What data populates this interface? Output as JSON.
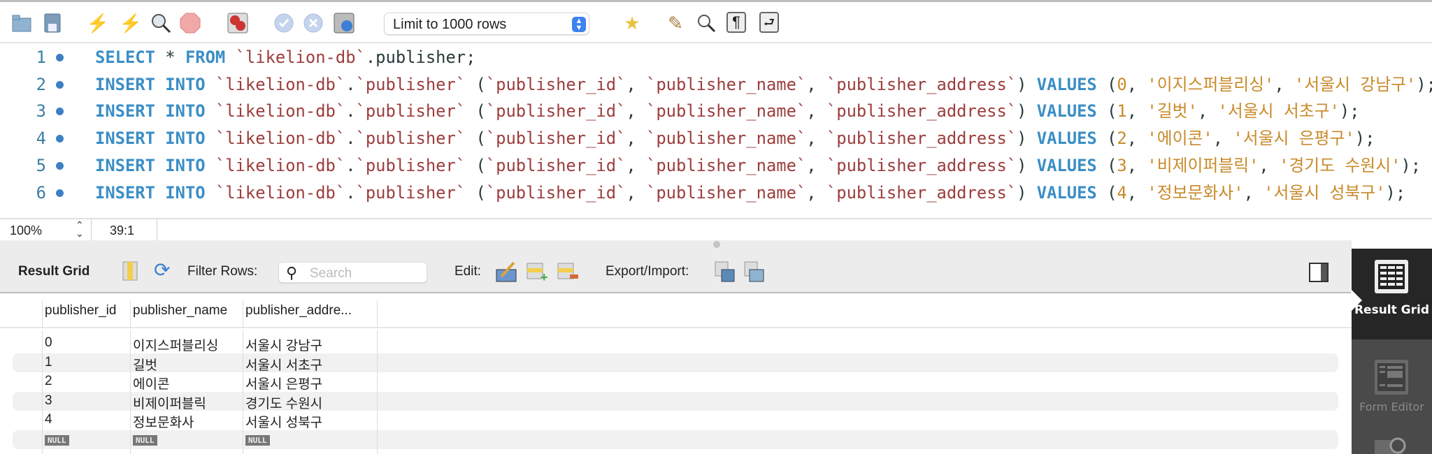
{
  "toolbar": {
    "icons": [
      "open-folder-icon",
      "save-icon",
      "execute-icon",
      "execute-current-icon",
      "explain-icon",
      "stop-icon",
      "toggle-error-stop-icon",
      "commit-icon",
      "rollback-icon",
      "autocommit-icon",
      "add-snippet-icon",
      "beautify-icon",
      "find-icon",
      "invisible-chars-icon",
      "wrap-icon"
    ],
    "limit_select": "Limit to 1000 rows"
  },
  "editor": {
    "lines": [
      {
        "num": "1",
        "tokens": [
          [
            "kw",
            "SELECT"
          ],
          [
            "pl",
            " * "
          ],
          [
            "kw",
            "FROM"
          ],
          [
            "pl",
            " "
          ],
          [
            "id",
            "`likelion-db`"
          ],
          [
            "pl",
            ".publisher;"
          ]
        ]
      },
      {
        "num": "2",
        "tokens": [
          [
            "kw",
            "INSERT INTO"
          ],
          [
            "pl",
            " "
          ],
          [
            "id",
            "`likelion-db`"
          ],
          [
            "pl",
            "."
          ],
          [
            "id",
            "`publisher`"
          ],
          [
            "pl",
            " ("
          ],
          [
            "id",
            "`publisher_id`"
          ],
          [
            "pl",
            ", "
          ],
          [
            "id",
            "`publisher_name`"
          ],
          [
            "pl",
            ", "
          ],
          [
            "id",
            "`publisher_address`"
          ],
          [
            "pl",
            ") "
          ],
          [
            "kw",
            "VALUES"
          ],
          [
            "pl",
            " ("
          ],
          [
            "st",
            "0"
          ],
          [
            "pl",
            ", "
          ],
          [
            "st",
            "'이지스퍼블리싱'"
          ],
          [
            "pl",
            ", "
          ],
          [
            "st",
            "'서울시 강남구'"
          ],
          [
            "pl",
            ");"
          ]
        ]
      },
      {
        "num": "3",
        "tokens": [
          [
            "kw",
            "INSERT INTO"
          ],
          [
            "pl",
            " "
          ],
          [
            "id",
            "`likelion-db`"
          ],
          [
            "pl",
            "."
          ],
          [
            "id",
            "`publisher`"
          ],
          [
            "pl",
            " ("
          ],
          [
            "id",
            "`publisher_id`"
          ],
          [
            "pl",
            ", "
          ],
          [
            "id",
            "`publisher_name`"
          ],
          [
            "pl",
            ", "
          ],
          [
            "id",
            "`publisher_address`"
          ],
          [
            "pl",
            ") "
          ],
          [
            "kw",
            "VALUES"
          ],
          [
            "pl",
            " ("
          ],
          [
            "st",
            "1"
          ],
          [
            "pl",
            ", "
          ],
          [
            "st",
            "'길벗'"
          ],
          [
            "pl",
            ", "
          ],
          [
            "st",
            "'서울시 서초구'"
          ],
          [
            "pl",
            ");"
          ]
        ]
      },
      {
        "num": "4",
        "tokens": [
          [
            "kw",
            "INSERT INTO"
          ],
          [
            "pl",
            " "
          ],
          [
            "id",
            "`likelion-db`"
          ],
          [
            "pl",
            "."
          ],
          [
            "id",
            "`publisher`"
          ],
          [
            "pl",
            " ("
          ],
          [
            "id",
            "`publisher_id`"
          ],
          [
            "pl",
            ", "
          ],
          [
            "id",
            "`publisher_name`"
          ],
          [
            "pl",
            ", "
          ],
          [
            "id",
            "`publisher_address`"
          ],
          [
            "pl",
            ") "
          ],
          [
            "kw",
            "VALUES"
          ],
          [
            "pl",
            " ("
          ],
          [
            "st",
            "2"
          ],
          [
            "pl",
            ", "
          ],
          [
            "st",
            "'에이콘'"
          ],
          [
            "pl",
            ", "
          ],
          [
            "st",
            "'서울시 은평구'"
          ],
          [
            "pl",
            ");"
          ]
        ]
      },
      {
        "num": "5",
        "tokens": [
          [
            "kw",
            "INSERT INTO"
          ],
          [
            "pl",
            " "
          ],
          [
            "id",
            "`likelion-db`"
          ],
          [
            "pl",
            "."
          ],
          [
            "id",
            "`publisher`"
          ],
          [
            "pl",
            " ("
          ],
          [
            "id",
            "`publisher_id`"
          ],
          [
            "pl",
            ", "
          ],
          [
            "id",
            "`publisher_name`"
          ],
          [
            "pl",
            ", "
          ],
          [
            "id",
            "`publisher_address`"
          ],
          [
            "pl",
            ") "
          ],
          [
            "kw",
            "VALUES"
          ],
          [
            "pl",
            " ("
          ],
          [
            "st",
            "3"
          ],
          [
            "pl",
            ", "
          ],
          [
            "st",
            "'비제이퍼블릭'"
          ],
          [
            "pl",
            ", "
          ],
          [
            "st",
            "'경기도 수원시'"
          ],
          [
            "pl",
            ");"
          ]
        ]
      },
      {
        "num": "6",
        "tokens": [
          [
            "kw",
            "INSERT INTO"
          ],
          [
            "pl",
            " "
          ],
          [
            "id",
            "`likelion-db`"
          ],
          [
            "pl",
            "."
          ],
          [
            "id",
            "`publisher`"
          ],
          [
            "pl",
            " ("
          ],
          [
            "id",
            "`publisher_id`"
          ],
          [
            "pl",
            ", "
          ],
          [
            "id",
            "`publisher_name`"
          ],
          [
            "pl",
            ", "
          ],
          [
            "id",
            "`publisher_address`"
          ],
          [
            "pl",
            ") "
          ],
          [
            "kw",
            "VALUES"
          ],
          [
            "pl",
            " ("
          ],
          [
            "st",
            "4"
          ],
          [
            "pl",
            ", "
          ],
          [
            "st",
            "'정보문화사'"
          ],
          [
            "pl",
            ", "
          ],
          [
            "st",
            "'서울시 성북구'"
          ],
          [
            "pl",
            ");"
          ]
        ]
      }
    ]
  },
  "status": {
    "zoom": "100%",
    "position": "39:1"
  },
  "result_toolbar": {
    "title": "Result Grid",
    "filter_label": "Filter Rows:",
    "search_placeholder": "Search",
    "edit_label": "Edit:",
    "export_label": "Export/Import:"
  },
  "grid": {
    "columns": [
      "publisher_id",
      "publisher_name",
      "publisher_addre..."
    ],
    "rows": [
      [
        "0",
        "이지스퍼블리싱",
        "서울시 강남구"
      ],
      [
        "1",
        "길벗",
        "서울시 서초구"
      ],
      [
        "2",
        "에이콘",
        "서울시 은평구"
      ],
      [
        "3",
        "비제이퍼블릭",
        "경기도 수원시"
      ],
      [
        "4",
        "정보문화사",
        "서울시 성북구"
      ],
      [
        "NULL",
        "NULL",
        "NULL"
      ]
    ]
  },
  "side_panel": {
    "result_grid": "Result Grid",
    "form_editor": "Form Editor"
  }
}
